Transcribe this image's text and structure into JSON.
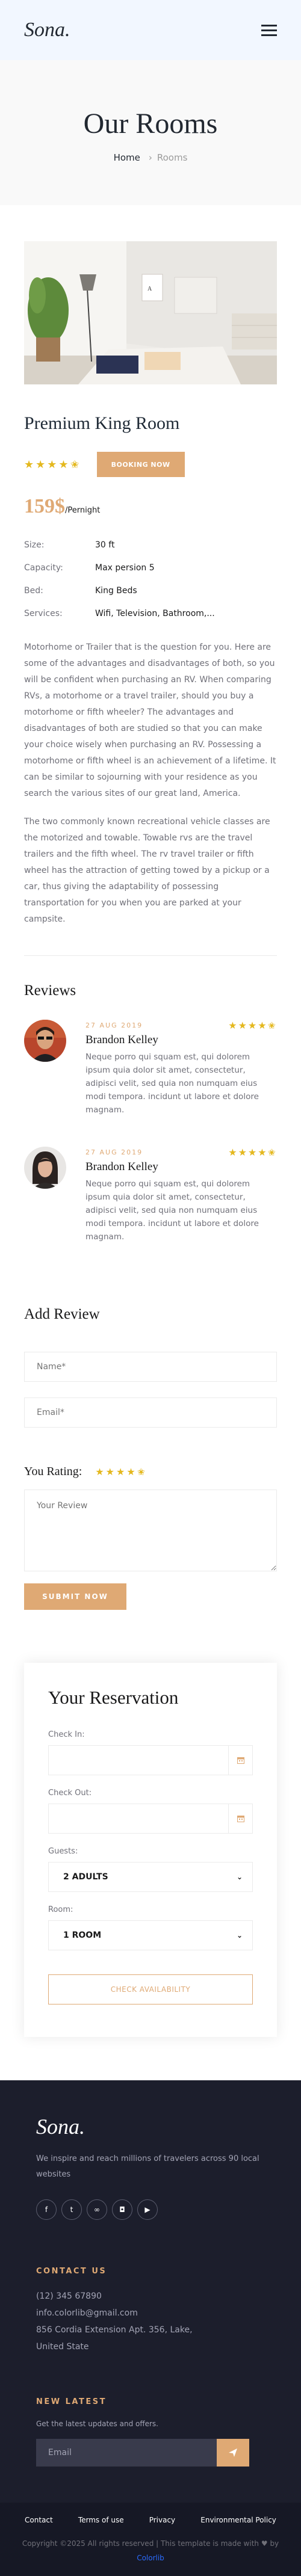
{
  "header": {
    "logo": "Sona."
  },
  "hero": {
    "title": "Our Rooms",
    "crumb_home": "Home",
    "crumb_current": "Rooms"
  },
  "room": {
    "title": "Premium King Room",
    "rating_stars": "★★★★✬",
    "book_label": "BOOKING NOW",
    "price": "159$",
    "price_unit": "/Pernight",
    "specs": [
      {
        "k": "Size:",
        "v": "30 ft"
      },
      {
        "k": "Capacity:",
        "v": "Max persion 5"
      },
      {
        "k": "Bed:",
        "v": "King Beds"
      },
      {
        "k": "Services:",
        "v": "Wifi, Television, Bathroom,..."
      }
    ],
    "desc1": "Motorhome or Trailer that is the question for you. Here are some of the advantages and disadvantages of both, so you will be confident when purchasing an RV. When comparing RVs, a motorhome or a travel trailer, should you buy a motorhome or fifth wheeler? The advantages and disadvantages of both are studied so that you can make your choice wisely when purchasing an RV. Possessing a motorhome or fifth wheel is an achievement of a lifetime. It can be similar to sojourning with your residence as you search the various sites of our great land, America.",
    "desc2": "The two commonly known recreational vehicle classes are the motorized and towable. Towable rvs are the travel trailers and the fifth wheel. The rv travel trailer or fifth wheel has the attraction of getting towed by a pickup or a car, thus giving the adaptability of possessing transportation for you when you are parked at your campsite."
  },
  "reviews": {
    "title": "Reviews",
    "items": [
      {
        "date": "27 AUG 2019",
        "stars": "★★★★✬",
        "name": "Brandon Kelley",
        "text": "Neque porro qui squam est, qui dolorem ipsum quia dolor sit amet, consectetur, adipisci velit, sed quia non numquam eius modi tempora. incidunt ut labore et dolore magnam."
      },
      {
        "date": "27 AUG 2019",
        "stars": "★★★★✬",
        "name": "Brandon Kelley",
        "text": "Neque porro qui squam est, qui dolorem ipsum quia dolor sit amet, consectetur, adipisci velit, sed quia non numquam eius modi tempora. incidunt ut labore et dolore magnam."
      }
    ]
  },
  "add_review": {
    "title": "Add Review",
    "name_placeholder": "Name*",
    "email_placeholder": "Email*",
    "rating_label": "You Rating:",
    "rating_stars": "★★★★✬",
    "review_placeholder": "Your Review",
    "submit_label": "SUBMIT NOW"
  },
  "reservation": {
    "title": "Your Reservation",
    "checkin_label": "Check In:",
    "checkout_label": "Check Out:",
    "guests_label": "Guests:",
    "guests_value": "2 ADULTS",
    "room_label": "Room:",
    "room_value": "1 ROOM",
    "check_label": "CHECK AVAILABILITY"
  },
  "footer": {
    "logo": "Sona.",
    "about": "We inspire and reach millions of travelers across 90 local websites",
    "socials": [
      "facebook-icon",
      "twitter-icon",
      "tripadvisor-icon",
      "instagram-icon",
      "youtube-icon"
    ],
    "contact_title": "CONTACT US",
    "phone": "(12) 345 67890",
    "email": "info.colorlib@gmail.com",
    "address1": "856 Cordia Extension Apt. 356, Lake,",
    "address2": "United State",
    "news_title": "NEW LATEST",
    "news_text": "Get the latest updates and offers.",
    "news_placeholder": "Email",
    "links": [
      "Contact",
      "Terms of use",
      "Privacy",
      "Environmental Policy"
    ],
    "copyright": "Copyright ©2025 All rights reserved | This template is made with",
    "by": "by",
    "brand": "Colorlib"
  },
  "colors": {
    "accent": "#dfa974",
    "star": "#e4b81e",
    "footer_bg": "#1c1e2c",
    "header_bg": "#f2f7ff"
  }
}
